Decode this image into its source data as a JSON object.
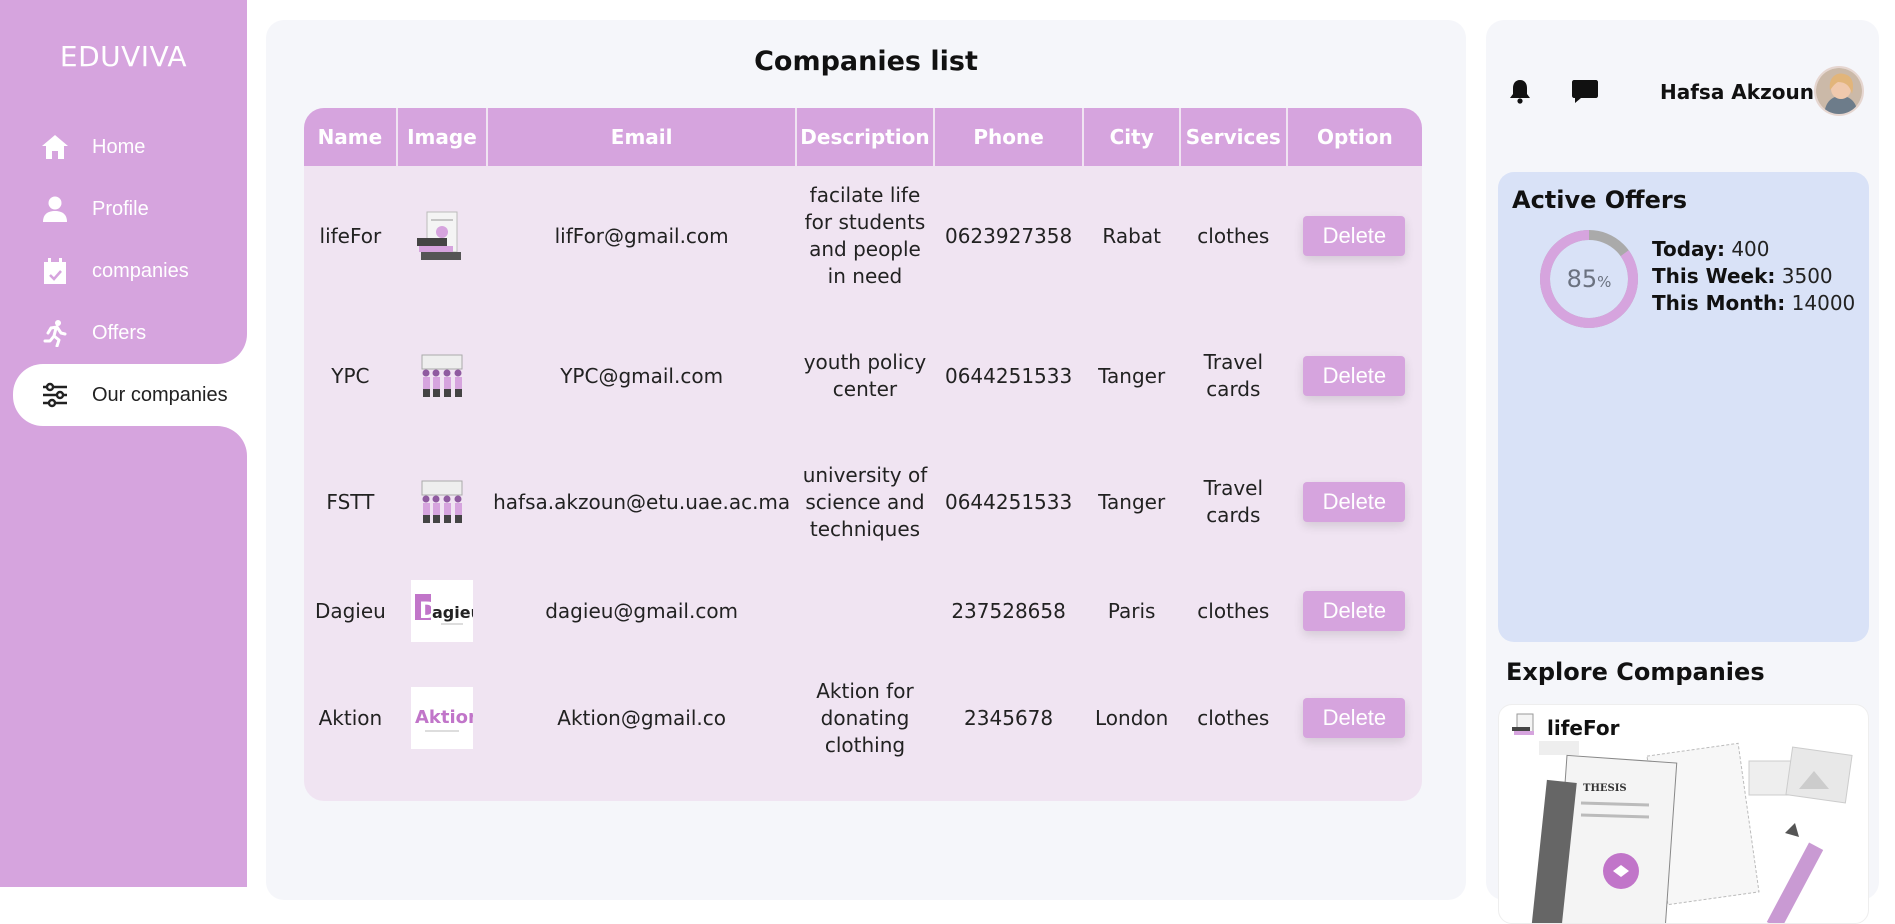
{
  "app": {
    "brand": "EDUVIVA"
  },
  "sidebar": {
    "items": [
      {
        "label": "Home",
        "icon": "home-icon"
      },
      {
        "label": "Profile",
        "icon": "user-icon"
      },
      {
        "label": "companies",
        "icon": "calendar-icon"
      },
      {
        "label": "Offers",
        "icon": "running-icon"
      },
      {
        "label": "Our companies",
        "icon": "sliders-icon",
        "active": true
      }
    ]
  },
  "main": {
    "title": "Companies list",
    "columns": [
      "Name",
      "Image",
      "Email",
      "Description",
      "Phone",
      "City",
      "Services",
      "Option"
    ],
    "rows": [
      {
        "name": "lifeFor",
        "image": "lifefor-logo",
        "email": "lifFor@gmail.com",
        "description": "facilate life for students and people in need",
        "phone": "0623927358",
        "city": "Rabat",
        "services": "clothes",
        "option": "Delete"
      },
      {
        "name": "YPC",
        "image": "ypc-logo",
        "email": "YPC@gmail.com",
        "description": "youth policy center",
        "phone": "0644251533",
        "city": "Tanger",
        "services": "Travel cards",
        "option": "Delete"
      },
      {
        "name": "FSTT",
        "image": "fstt-logo",
        "email": "hafsa.akzoun@etu.uae.ac.ma",
        "description": "university of science and techniques",
        "phone": "0644251533",
        "city": "Tanger",
        "services": "Travel cards",
        "option": "Delete"
      },
      {
        "name": "Dagieu",
        "image": "dagieu-logo",
        "email": "dagieu@gmail.com",
        "description": "",
        "phone": "237528658",
        "city": "Paris",
        "services": "clothes",
        "option": "Delete"
      },
      {
        "name": "Aktion",
        "image": "aktion-logo",
        "email": "Aktion@gmail.co",
        "description": "Aktion for donating clothing",
        "phone": "2345678",
        "city": "London",
        "services": "clothes",
        "option": "Delete"
      }
    ]
  },
  "header": {
    "user_name": "Hafsa Akzoun",
    "notification_icon": "bell-icon",
    "message_icon": "chat-icon"
  },
  "offers": {
    "title": "Active Offers",
    "percent": "85",
    "percent_sign": "%",
    "percent_fraction": 0.85,
    "today_label": "Today:",
    "today_value": "400",
    "week_label": "This Week:",
    "week_value": "3500",
    "month_label": "This Month:",
    "month_value": "14000",
    "ring_color": "#d6a4de",
    "ring_track_color": "#aaaaaa"
  },
  "explore": {
    "title": "Explore Companies",
    "card_name": "lifeFor",
    "card_image_text": "THESIS"
  },
  "colors": {
    "accent": "#d6a4de",
    "table_bg": "#f0e4f2",
    "offers_bg": "#d9e2f7"
  }
}
